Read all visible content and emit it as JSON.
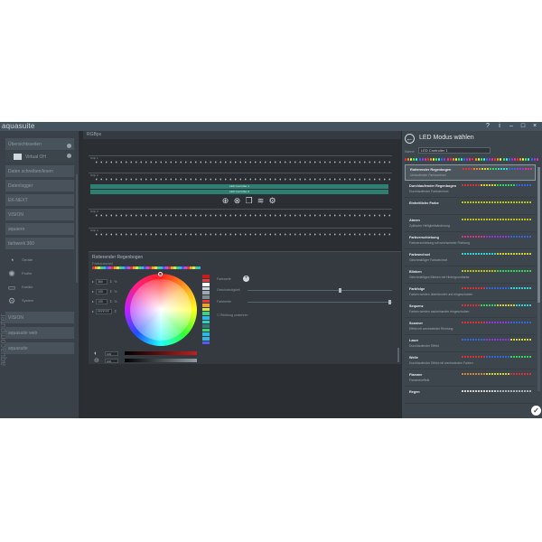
{
  "app": {
    "title": "aquasuite"
  },
  "window_controls": {
    "help": "?",
    "info": "i",
    "minimize": "–",
    "maximize": "□",
    "close": "×"
  },
  "icons": {
    "back": "arrow-left-circle-icon",
    "confirm": "checkmark-circle-icon",
    "add": "plus-circle-icon",
    "home": "home-icon",
    "light": "bulb-icon",
    "edit": "pencil-icon",
    "settings": "gear-icon"
  },
  "sidebar": {
    "items": [
      {
        "label": "Übersichtsseiten"
      },
      {
        "label": "Virtual OH",
        "sub": true
      },
      {
        "label": "Daten schreiben/lesen"
      },
      {
        "label": "Datenlogger"
      },
      {
        "label": "EK-NEXT"
      },
      {
        "label": "VISION"
      },
      {
        "label": "aquaero"
      },
      {
        "label": "farbwerk 360"
      },
      {
        "label": "VISION"
      },
      {
        "label": "aquasuite web"
      },
      {
        "label": "aquasuite"
      }
    ],
    "subs": [
      {
        "label": "Geräte"
      },
      {
        "label": "Profile"
      },
      {
        "label": "Kanäle"
      },
      {
        "label": "System"
      }
    ],
    "brand": "aquacomputer"
  },
  "main": {
    "header": "RGBpx",
    "strip_labels": [
      "Strip 1",
      "Strip 2",
      "Strip 3",
      "Strip 4"
    ],
    "controller_bars": [
      "LED Controller 1",
      "LED Controller 2"
    ],
    "panel": {
      "title": "Rotierender Regenbogen",
      "subtitle": "Farbauswahl",
      "num_fields": [
        {
          "value": "360",
          "unit": "%"
        },
        {
          "value": "100",
          "unit": "%"
        },
        {
          "value": "100",
          "unit": "%"
        },
        {
          "value": "FFFFFF",
          "unit": ""
        }
      ],
      "right_labels": {
        "effect": "Farbwerte",
        "speed": "Geschwindigkeit",
        "width": "Farbbreite",
        "direction": "Richtung umkehren"
      },
      "brightness_value": "100",
      "saturation_value": "100"
    }
  },
  "led_panel": {
    "title": "LED Modus wählen",
    "name_label": "Name",
    "name_value": "LED Controller 1",
    "modes": [
      {
        "name": "Rotierender Regenbogen",
        "desc": "Umlaufender Farbwechsel",
        "selected": true
      },
      {
        "name": "Durchlaufender Regenbogen",
        "desc": "Durchlaufender Farbwechsel"
      },
      {
        "name": "Einheitliche Farbe",
        "desc": ""
      },
      {
        "name": "Atmen",
        "desc": "Zyklische Helligkeitsänderung"
      },
      {
        "name": "Farbverschiebung",
        "desc": "Farbverschiebung mit wechselnder Richtung"
      },
      {
        "name": "Farbwechsel",
        "desc": "Gleichmäßiger Farbwechsel"
      },
      {
        "name": "Blinken",
        "desc": "Gleichmäßiges Blinken mit Hintergrundfarbe"
      },
      {
        "name": "Farbfolge",
        "desc": "Farben werden überblendet und eingeschoben"
      },
      {
        "name": "Sequenz",
        "desc": "Farben werden nacheinander eingeschoben"
      },
      {
        "name": "Scanner",
        "desc": "Effekt mit wechselnder Richtung"
      },
      {
        "name": "Laser",
        "desc": "Durchlaufender Effekt"
      },
      {
        "name": "Welle",
        "desc": "Durchlaufender Effekt mit wechselnden Farben"
      },
      {
        "name": "Flamme",
        "desc": "Flammeneffekt"
      },
      {
        "name": "Regen",
        "desc": ""
      }
    ],
    "confirm_label": "✓"
  },
  "colors": {
    "background": "#2a2d31",
    "panel": "#3e464d",
    "accent_teal": "#2f7e72",
    "selected_border": "#8e9aa1"
  }
}
